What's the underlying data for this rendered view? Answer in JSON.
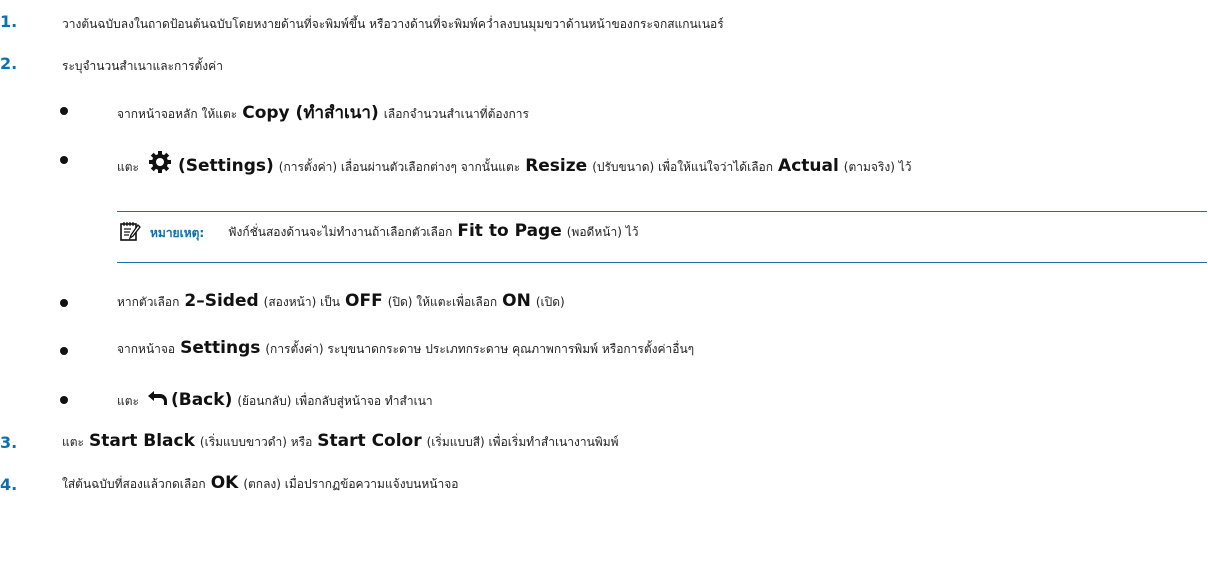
{
  "steps": [
    {
      "number": "1.",
      "text": "วางต้นฉบับลงในถาดป้อนต้นฉบับโดยหงายด้านที่จะพิมพ์ขึ้น หรือวางด้านที่จะพิมพ์คว่ำลงบนมุมขวาด้านหน้าของกระจกสแกนเนอร์"
    },
    {
      "number": "2.",
      "text": "ระบุจำนวนสำเนาและการตั้งค่า",
      "bullets": [
        {
          "pre": "จากหน้าจอหลัก ให้แตะ",
          "bold": "Copy (ทำสำเนา)",
          "post": "เลือกจำนวนสำเนาที่ต้องการ"
        },
        {
          "pre": "แตะ",
          "icon": "gear-icon",
          "bold1": "(Settings)",
          "mid1": "(การตั้งค่า) เลื่อนผ่านตัวเลือกต่างๆ จากนั้นแตะ",
          "bold2": "Resize",
          "mid2": "(ปรับขนาด) เพื่อให้แน่ใจว่าได้เลือก",
          "bold3": "Actual",
          "post": "(ตามจริง) ไว้"
        }
      ],
      "note": {
        "icon": "note-pad-icon",
        "label": "หมายเหตุ:",
        "pre": "ฟังก์ชั่นสองด้านจะไม่ทำงานถ้าเลือกตัวเลือก",
        "bold": "Fit to Page",
        "post": "(พอดีหน้า) ไว้"
      },
      "bullets2": [
        {
          "pre": "หากตัวเลือก",
          "bold1": "2–Sided",
          "mid1": "(สองหน้า) เป็น",
          "bold2": "OFF",
          "mid2": "(ปิด) ให้แตะเพื่อเลือก",
          "bold3": "ON",
          "post": "(เปิด)"
        },
        {
          "pre": "จากหน้าจอ",
          "bold": "Settings",
          "post": "(การตั้งค่า) ระบุขนาดกระดาษ ประเภทกระดาษ คุณภาพการพิมพ์ หรือการตั้งค่าอื่นๆ"
        },
        {
          "pre": "แตะ",
          "icon": "back-arrow-icon",
          "bold": "(Back)",
          "post": "(ย้อนกลับ) เพื่อกลับสู่หน้าจอ ทำสำเนา"
        }
      ]
    },
    {
      "number": "3.",
      "pre": "แตะ",
      "bold1": "Start Black",
      "mid": "(เริ่มแบบขาวดำ) หรือ",
      "bold2": "Start Color",
      "post": "(เริ่มแบบสี) เพื่อเริ่มทำสำเนางานพิมพ์"
    },
    {
      "number": "4.",
      "pre": "ใส่ต้นฉบับที่สองแล้วกดเลือก",
      "bold": "OK",
      "post": "(ตกลง) เมื่อปรากฏข้อความแจ้งบนหน้าจอ"
    }
  ],
  "colors": {
    "accent": "#0b6fb0",
    "text": "#222222",
    "rule": "#1e6fa8"
  }
}
